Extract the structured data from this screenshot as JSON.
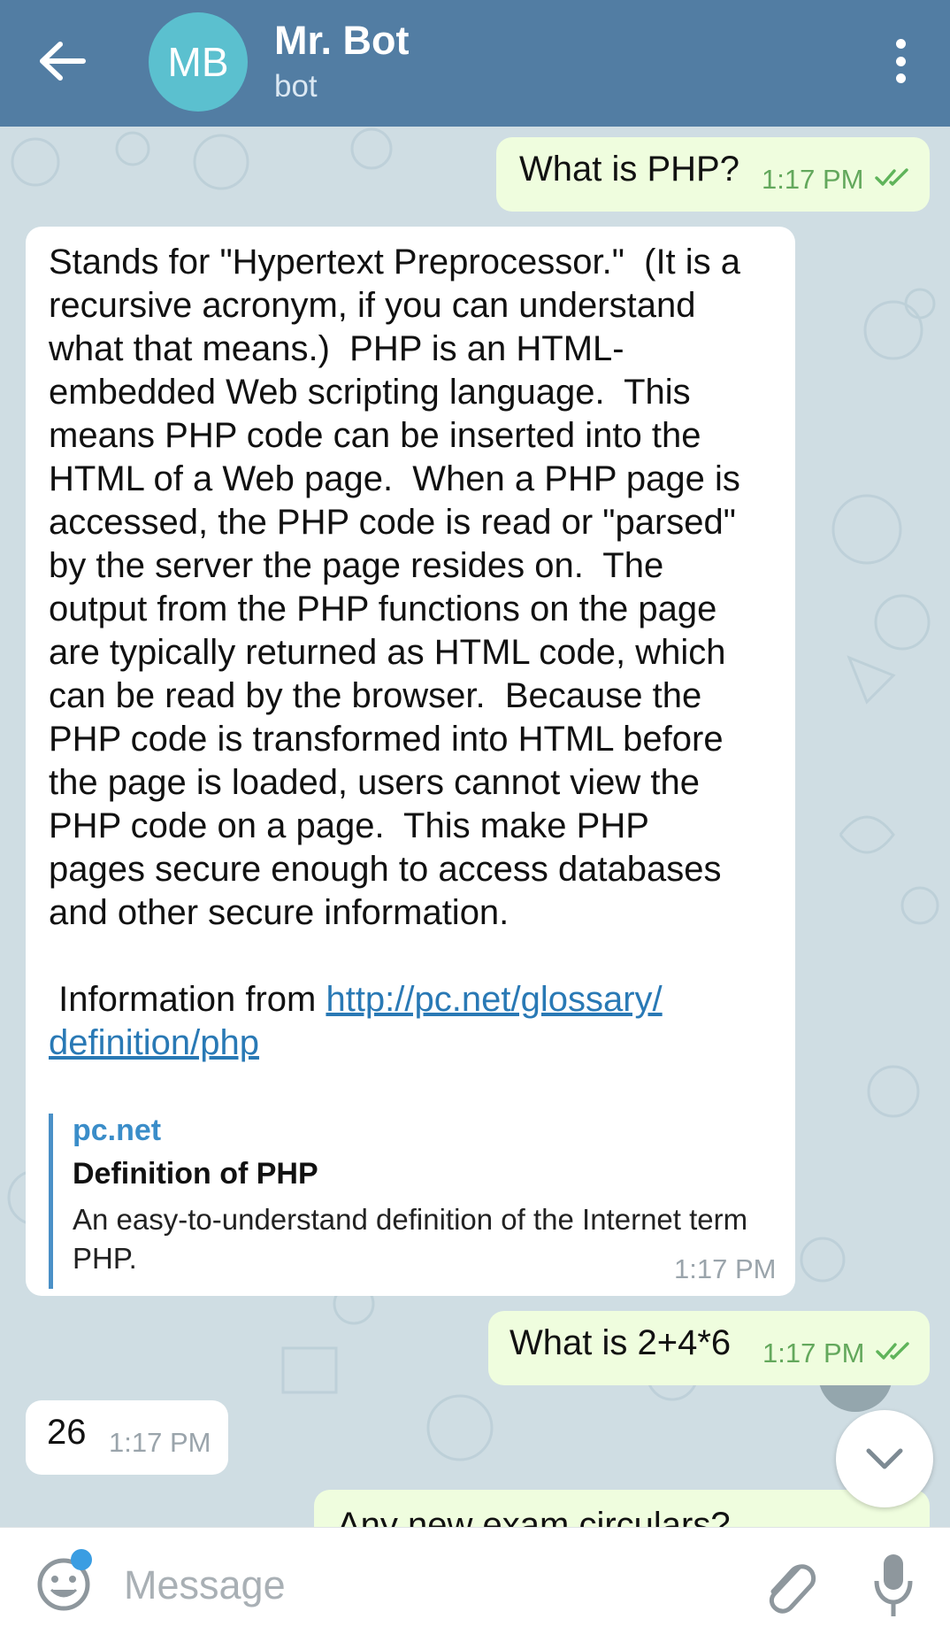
{
  "header": {
    "title": "Mr. Bot",
    "subtitle": "bot",
    "avatar_initials": "MB",
    "avatar_color": "#5bc0cf",
    "bar_color": "#527da3"
  },
  "messages": {
    "m1": {
      "text": "What is PHP?",
      "time": "1:17 PM"
    },
    "m2": {
      "body": "Stands for \"Hypertext Preprocessor.\"  (It is a\nrecursive acronym, if you can understand\nwhat that means.)  PHP is an HTML-\nembedded Web scripting language.  This\nmeans PHP code can be inserted into the\nHTML of a Web page.  When a PHP page is\naccessed, the PHP code is read or \"parsed\"\nby the server the page resides on.  The\noutput from the PHP functions on the page\nare typically returned as HTML code, which\ncan be read by the browser.  Because the\nPHP code is transformed into HTML before\nthe page is loaded, users cannot view the\nPHP code on a page.  This make PHP\npages secure enough to access databases\nand other secure information.\n\n Information from ",
      "link_part1": "http://pc.net/glossary/",
      "link_part2": "definition/php",
      "preview_site": "pc.net",
      "preview_title": "Definition of PHP",
      "preview_desc": "An easy-to-understand definition of the Internet term PHP.",
      "time": "1:17 PM"
    },
    "m3": {
      "text": "What is 2+4*6",
      "time": "1:17 PM"
    },
    "m4": {
      "text": "26",
      "time": "1:17 PM"
    },
    "m5": {
      "text": "Any new exam circulars?"
    }
  },
  "composer": {
    "placeholder": "Message"
  },
  "icons": {
    "back": "arrow-left-icon",
    "menu": "more-vertical-icon",
    "share": "share-icon",
    "scroll": "chevron-down-icon",
    "emoji": "emoji-icon",
    "attach": "paperclip-icon",
    "mic": "microphone-icon"
  }
}
